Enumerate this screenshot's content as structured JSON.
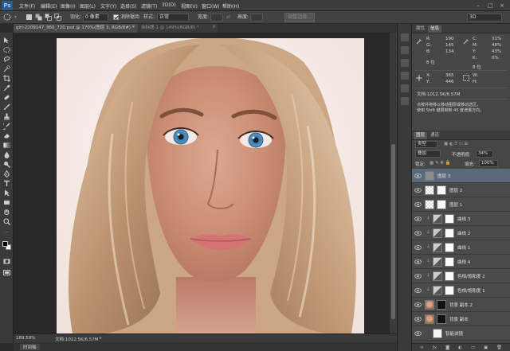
{
  "app": {
    "logo": "Ps"
  },
  "menu": [
    "文件(F)",
    "编辑(E)",
    "图像(I)",
    "图层(L)",
    "文字(Y)",
    "选择(S)",
    "滤镜(T)",
    "3D(D)",
    "视图(V)",
    "窗口(W)",
    "帮助(H)"
  ],
  "options": {
    "feather_label": "羽化:",
    "feather_value": "0 像素",
    "antialias_label": "消除锯齿",
    "antialias_checked": true,
    "style_label": "样式:",
    "style_value": "正常",
    "width_label": "宽度:",
    "height_label": "高度:",
    "refine_edge": "调整边缘...",
    "workspace": "3D"
  },
  "tabs": [
    {
      "label": "girl-2209147_960_720.psd @ 170%(图层 3, RGB/8#) *",
      "active": true
    },
    {
      "label": "未标题-1 @ 149%(RGB/8) *",
      "active": false
    }
  ],
  "status": {
    "zoom": "169.59%",
    "doc_info": "文档:1012.5K/6.57M"
  },
  "bottom_tab": "时间轴",
  "info_panel": {
    "tabs": [
      "属性",
      "信息"
    ],
    "rgb": [
      {
        "k": "R:",
        "v": "190"
      },
      {
        "k": "G:",
        "v": "145"
      },
      {
        "k": "B:",
        "v": "134"
      }
    ],
    "cmyk": [
      {
        "k": "C:",
        "v": "31%"
      },
      {
        "k": "M:",
        "v": "48%"
      },
      {
        "k": "Y:",
        "v": "43%"
      },
      {
        "k": "K:",
        "v": "0%"
      }
    ],
    "bits_left": "8 位",
    "bits_right": "8 位",
    "xy": [
      {
        "k": "X:",
        "v": "365"
      },
      {
        "k": "Y:",
        "v": "446"
      }
    ],
    "wh": [
      {
        "k": "W:",
        "v": ""
      },
      {
        "k": "H:",
        "v": ""
      }
    ],
    "doc": "文档:1012.5K/6.57M",
    "hint_line1": "点按并拖移以移动图层或移动选区。",
    "hint_line2": "使用 Shift 键限制到 45 度增量方向。"
  },
  "layers_panel": {
    "tabs": [
      "图层",
      "通道"
    ],
    "kind_label": "类型",
    "blend_mode": "叠加",
    "opacity_label": "不透明度:",
    "opacity_value": "34%",
    "lock_label": "锁定:",
    "fill_label": "填充:",
    "fill_value": "100%",
    "layers": [
      {
        "name": "图层 3",
        "selected": true,
        "thumb": "gray",
        "mask": false
      },
      {
        "name": "图层 2",
        "selected": false,
        "thumb": "checker",
        "mask": true
      },
      {
        "name": "图层 1",
        "selected": false,
        "thumb": "checker",
        "mask": true
      },
      {
        "name": "曲线 3",
        "selected": false,
        "thumb": "adjust",
        "mask": true
      },
      {
        "name": "曲线 2",
        "selected": false,
        "thumb": "adjust",
        "mask": true
      },
      {
        "name": "曲线 1",
        "selected": false,
        "thumb": "adjust",
        "mask": true
      },
      {
        "name": "曲线 4",
        "selected": false,
        "thumb": "adjust",
        "mask": true
      },
      {
        "name": "色相/饱和度 2",
        "selected": false,
        "thumb": "adjust",
        "mask": true
      },
      {
        "name": "色相/饱和度 1",
        "selected": false,
        "thumb": "adjust",
        "mask": true
      },
      {
        "name": "背景 副本 2",
        "selected": false,
        "thumb": "photo",
        "mask": true
      },
      {
        "name": "背景 副本",
        "selected": false,
        "thumb": "photo",
        "mask": true
      },
      {
        "name": "智能滤镜",
        "selected": false,
        "thumb": "white",
        "mask": false
      }
    ]
  },
  "colors": {
    "accent": "#2a5d89",
    "selected_layer": "#5a6a7a",
    "eye_blue": "#3d7fb5"
  }
}
